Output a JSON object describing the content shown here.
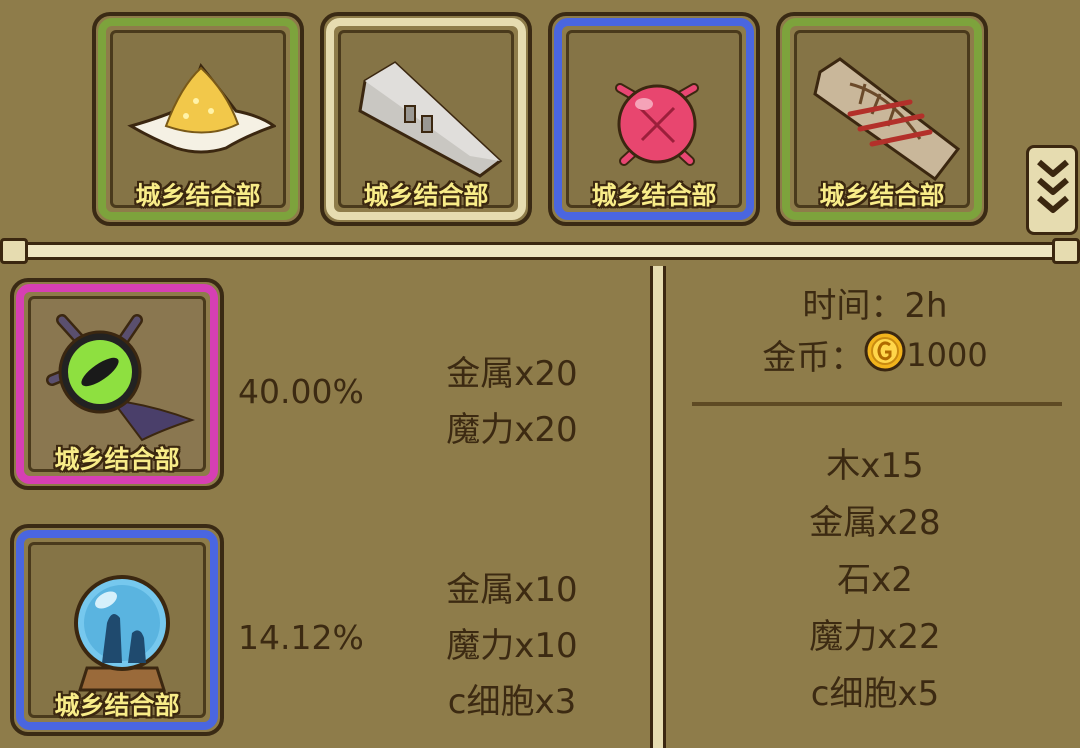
{
  "colors": {
    "background": "#8e7c4a",
    "text": "#3c2a12",
    "rarity_green": "#7da33c",
    "rarity_white": "#e6dcb0",
    "rarity_blue": "#4a66e0",
    "rarity_pink": "#d63fb4",
    "gold_coin": "#f2b41c"
  },
  "top_items": [
    {
      "icon": "grain-pile-icon",
      "label": "城乡结合部",
      "rarity": "green"
    },
    {
      "icon": "stone-slab-icon",
      "label": "城乡结合部",
      "rarity": "white"
    },
    {
      "icon": "red-spiky-orb-icon",
      "label": "城乡结合部",
      "rarity": "blue"
    },
    {
      "icon": "fish-fossil-icon",
      "label": "城乡结合部",
      "rarity": "green"
    }
  ],
  "expand_icon": "double-chevron-down-icon",
  "results": [
    {
      "icon": "green-eye-orb-icon",
      "label": "城乡结合部",
      "rarity": "pink",
      "chance": "40.00%",
      "costs": [
        "金属x20",
        "魔力x20"
      ]
    },
    {
      "icon": "crystal-ball-icon",
      "label": "城乡结合部",
      "rarity": "blue",
      "chance": "14.12%",
      "costs": [
        "金属x10",
        "魔力x10",
        "c细胞x3"
      ]
    }
  ],
  "summary": {
    "time": "时间：2h",
    "coin_label": "金币：",
    "coin_icon": "gold-coin-icon",
    "coin_value": "1000",
    "materials": [
      "木x15",
      "金属x28",
      "石x2",
      "魔力x22",
      "c细胞x5"
    ]
  }
}
